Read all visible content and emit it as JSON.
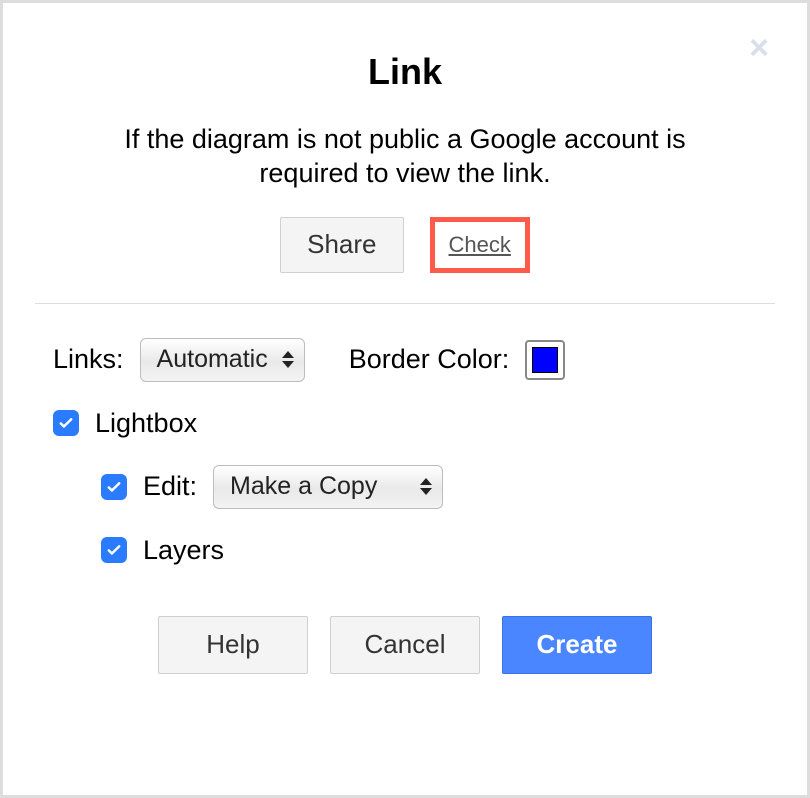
{
  "dialog": {
    "title": "Link",
    "description": "If the diagram is not public a Google account is required to view the link.",
    "close_glyph": "×"
  },
  "actions": {
    "share_label": "Share",
    "check_label": "Check"
  },
  "options": {
    "links_label": "Links:",
    "links_value": "Automatic",
    "border_color_label": "Border Color:",
    "border_color_value": "#0000ff",
    "lightbox_label": "Lightbox",
    "lightbox_checked": true,
    "edit_label": "Edit:",
    "edit_value": "Make a Copy",
    "edit_checked": true,
    "layers_label": "Layers",
    "layers_checked": true
  },
  "footer": {
    "help_label": "Help",
    "cancel_label": "Cancel",
    "create_label": "Create"
  }
}
